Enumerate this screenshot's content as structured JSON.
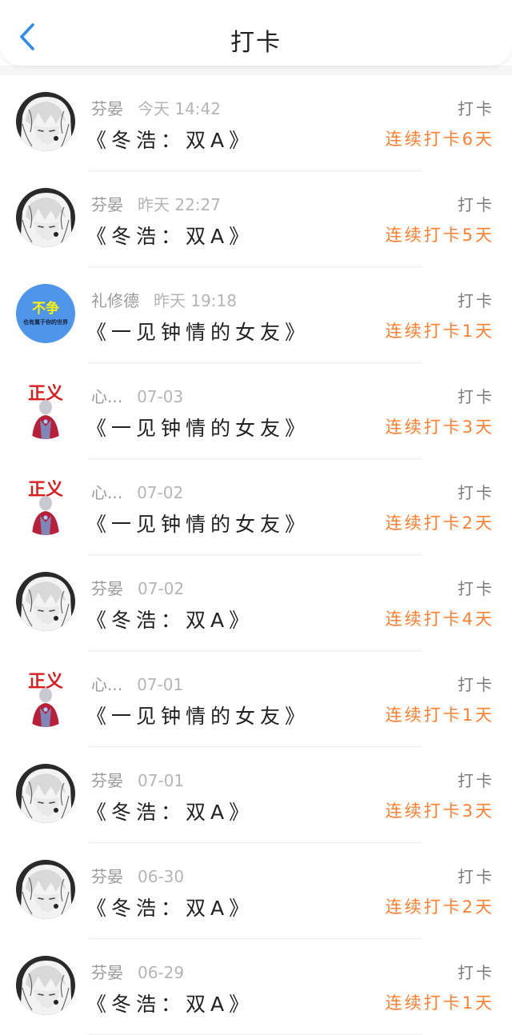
{
  "header": {
    "title": "打卡",
    "back_icon": "chevron-left-icon",
    "accent_color": "#2f8cf2"
  },
  "feed": {
    "streak_color": "#ff7f32",
    "items": [
      {
        "user": "芬晏",
        "time": "今天 14:42",
        "book": "《冬浩：双A》",
        "action": "打卡",
        "streak": "连续打卡6天",
        "avatar": "anime-avatar"
      },
      {
        "user": "芬晏",
        "time": "昨天 22:27",
        "book": "《冬浩：双A》",
        "action": "打卡",
        "streak": "连续打卡5天",
        "avatar": "anime-avatar"
      },
      {
        "user": "礼修德",
        "time": "昨天 19:18",
        "book": "《一见钟情的女友》",
        "action": "打卡",
        "streak": "连续打卡1天",
        "avatar": "text-avatar",
        "avatar_text": "不争",
        "avatar_subtext": "也有属于你的世界"
      },
      {
        "user": "心...",
        "time": "07-03",
        "book": "《一见钟情的女友》",
        "action": "打卡",
        "streak": "连续打卡3天",
        "avatar": "hero-avatar",
        "avatar_text": "正义"
      },
      {
        "user": "心...",
        "time": "07-02",
        "book": "《一见钟情的女友》",
        "action": "打卡",
        "streak": "连续打卡2天",
        "avatar": "hero-avatar",
        "avatar_text": "正义"
      },
      {
        "user": "芬晏",
        "time": "07-02",
        "book": "《冬浩：双A》",
        "action": "打卡",
        "streak": "连续打卡4天",
        "avatar": "anime-avatar"
      },
      {
        "user": "心...",
        "time": "07-01",
        "book": "《一见钟情的女友》",
        "action": "打卡",
        "streak": "连续打卡1天",
        "avatar": "hero-avatar",
        "avatar_text": "正义"
      },
      {
        "user": "芬晏",
        "time": "07-01",
        "book": "《冬浩：双A》",
        "action": "打卡",
        "streak": "连续打卡3天",
        "avatar": "anime-avatar"
      },
      {
        "user": "芬晏",
        "time": "06-30",
        "book": "《冬浩：双A》",
        "action": "打卡",
        "streak": "连续打卡2天",
        "avatar": "anime-avatar"
      },
      {
        "user": "芬晏",
        "time": "06-29",
        "book": "《冬浩：双A》",
        "action": "打卡",
        "streak": "连续打卡1天",
        "avatar": "anime-avatar"
      }
    ]
  }
}
